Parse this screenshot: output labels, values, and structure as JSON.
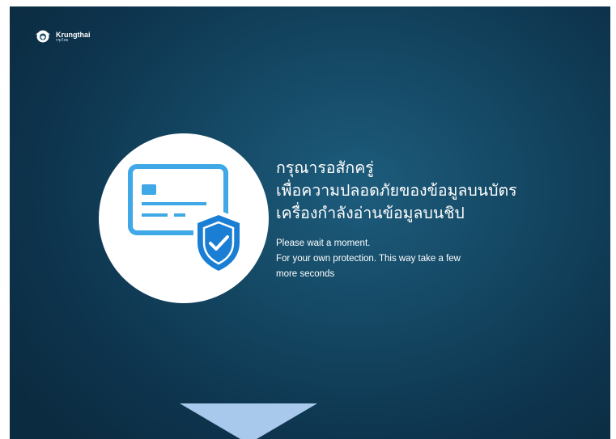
{
  "brand": {
    "name": "Krungthai",
    "thai_name": "กรุงไทย",
    "logo_icon": "krungthai-bird-logo"
  },
  "message": {
    "thai_lines": [
      "กรุณารอสักครู่",
      "เพื่อความปลอดภัยของข้อมูลบนบัตร",
      "เครื่องกำลังอ่านข้อมูลบนชิป"
    ],
    "english_lines": [
      "Please wait a moment.",
      "For your own protection. This way take a few",
      "more seconds"
    ]
  },
  "illustration": {
    "icon": "card-shield-check-icon",
    "card_color": "#3fa8e6",
    "shield_color": "#1a7fd4"
  },
  "colors": {
    "background": "#154a66",
    "arrow": "#a8c8ec"
  }
}
